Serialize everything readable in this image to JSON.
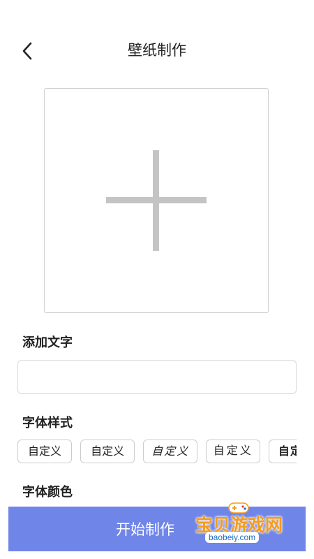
{
  "header": {
    "title": "壁纸制作",
    "back_icon": "chevron-left-icon"
  },
  "image_picker": {
    "icon": "plus-icon"
  },
  "add_text": {
    "label": "添加文字",
    "value": "",
    "placeholder": ""
  },
  "font_style": {
    "label": "字体样式",
    "options": [
      {
        "label": "自定义"
      },
      {
        "label": "自定义"
      },
      {
        "label": "自定义"
      },
      {
        "label": "自定义"
      },
      {
        "label": "自定义"
      }
    ]
  },
  "font_color": {
    "label": "字体颜色"
  },
  "start_button": {
    "label": "开始制作",
    "color": "#6f86e8"
  },
  "watermark": {
    "text": "宝贝游戏网",
    "url": "baobeiy.com"
  }
}
